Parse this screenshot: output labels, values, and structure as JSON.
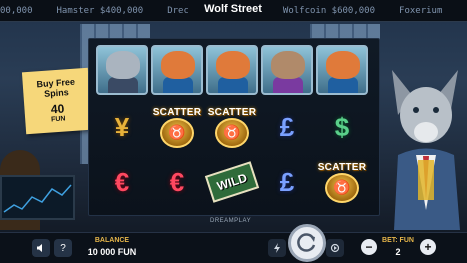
{
  "ticker": {
    "items": [
      "00,000",
      "Hamster $400,000",
      "Drec",
      "Wolfcoin $600,000",
      "Foxerium"
    ]
  },
  "game": {
    "title": "Wolf Street"
  },
  "bonus": {
    "line1": "Buy Free",
    "line2": "Spins",
    "price": "40",
    "currency": "FUN"
  },
  "reels": {
    "rows": [
      [
        "wolf",
        "fox",
        "fox",
        "hamster",
        "fox"
      ],
      [
        "yen",
        "scatter",
        "scatter",
        "pound",
        "dollar"
      ],
      [
        "euro",
        "euro",
        "wild",
        "pound",
        "scatter"
      ]
    ],
    "scatter_label": "SCATTER",
    "wild_label": "WILD",
    "symbols": {
      "yen": "¥",
      "euro": "€",
      "pound": "£",
      "dollar": "$"
    }
  },
  "provider": {
    "name": "DREAMPLAY"
  },
  "controls": {
    "balance_label": "BALANCE",
    "balance_value": "10 000 FUN",
    "bet_label": "BET: FUN",
    "bet_value": "2",
    "sound_icon": "speaker-icon",
    "help_label": "?",
    "minus_label": "−",
    "plus_label": "+"
  },
  "colors": {
    "accent": "#e6b64a",
    "note": "#f6d77a"
  }
}
